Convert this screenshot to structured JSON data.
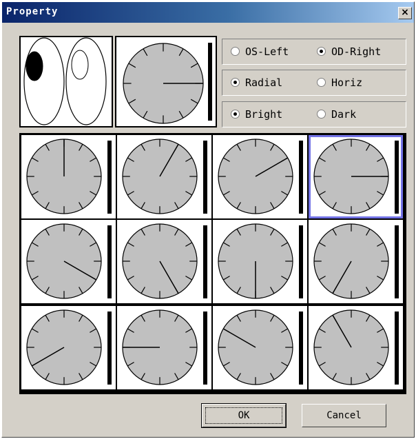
{
  "window": {
    "title": "Property",
    "close_label": "×"
  },
  "eye_selector": {
    "selected_eye": "left"
  },
  "eye_option": {
    "left_label": "OS-Left",
    "right_label": "OD-Right",
    "selected": "right"
  },
  "orientation_option": {
    "radial_label": "Radial",
    "horiz_label": "Horiz",
    "selected": "radial"
  },
  "polarity_option": {
    "bright_label": "Bright",
    "dark_label": "Dark",
    "selected": "bright"
  },
  "preview": {
    "hand_hour": 3
  },
  "dial_grid": {
    "selected_index": 3,
    "hand_hours": [
      0,
      1,
      2,
      3,
      4,
      5,
      6,
      7,
      8,
      9,
      10,
      11
    ]
  },
  "buttons": {
    "ok_label": "OK",
    "cancel_label": "Cancel"
  }
}
